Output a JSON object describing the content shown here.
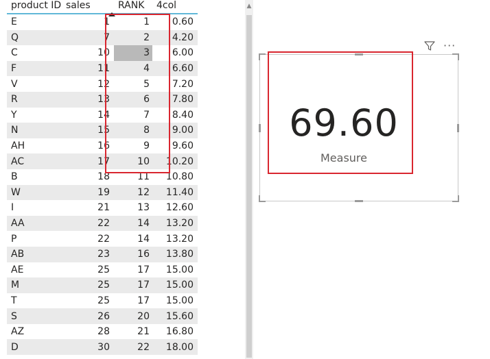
{
  "table": {
    "headers": [
      "product ID",
      "sales",
      "RANK",
      "4col"
    ],
    "rows": [
      [
        "E",
        "1",
        "1",
        "0.60"
      ],
      [
        "Q",
        "7",
        "2",
        "4.20"
      ],
      [
        "C",
        "10",
        "3",
        "6.00"
      ],
      [
        "F",
        "11",
        "4",
        "6.60"
      ],
      [
        "V",
        "12",
        "5",
        "7.20"
      ],
      [
        "R",
        "13",
        "6",
        "7.80"
      ],
      [
        "Y",
        "14",
        "7",
        "8.40"
      ],
      [
        "N",
        "15",
        "8",
        "9.00"
      ],
      [
        "AH",
        "16",
        "9",
        "9.60"
      ],
      [
        "AC",
        "17",
        "10",
        "10.20"
      ],
      [
        "B",
        "18",
        "11",
        "10.80"
      ],
      [
        "W",
        "19",
        "12",
        "11.40"
      ],
      [
        "I",
        "21",
        "13",
        "12.60"
      ],
      [
        "AA",
        "22",
        "14",
        "13.20"
      ],
      [
        "P",
        "22",
        "14",
        "13.20"
      ],
      [
        "AB",
        "23",
        "16",
        "13.80"
      ],
      [
        "AE",
        "25",
        "17",
        "15.00"
      ],
      [
        "M",
        "25",
        "17",
        "15.00"
      ],
      [
        "T",
        "25",
        "17",
        "15.00"
      ],
      [
        "S",
        "26",
        "20",
        "15.60"
      ],
      [
        "AZ",
        "28",
        "21",
        "16.80"
      ],
      [
        "D",
        "30",
        "22",
        "18.00"
      ]
    ],
    "sort_column": "RANK",
    "selected_cell": {
      "row": 2,
      "column": "RANK"
    }
  },
  "card": {
    "value": "69.60",
    "label": "Measure"
  },
  "icons": {
    "filter": "filter-icon",
    "more": "more-options-icon",
    "sort": "sort-ascending-icon"
  },
  "colors": {
    "header_underline": "#60b8d8",
    "highlight_box": "#d9262f",
    "alt_row": "#eaeaea",
    "selected_cell": "#b9b9b9"
  }
}
